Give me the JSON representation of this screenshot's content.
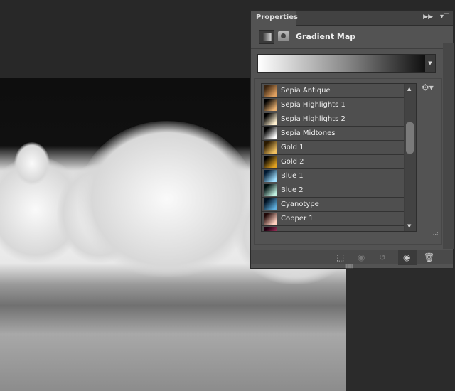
{
  "panel": {
    "tab": "Properties",
    "title": "Gradient Map",
    "collapse_icon": "double-arrow-right",
    "menu_icon": "panel-menu"
  },
  "gradient": {
    "from": "#ffffff",
    "to": "#000000"
  },
  "presets": [
    {
      "name": "Sepia Antique",
      "c": [
        "#3a2410",
        "#e0a060"
      ]
    },
    {
      "name": "Sepia Highlights 1",
      "c": [
        "#000000",
        "#e8b070"
      ]
    },
    {
      "name": "Sepia Highlights 2",
      "c": [
        "#000000",
        "#fff0d0"
      ]
    },
    {
      "name": "Sepia Midtones",
      "c": [
        "#000000",
        "#ffffff"
      ]
    },
    {
      "name": "Gold 1",
      "c": [
        "#2a1a00",
        "#f0c060"
      ]
    },
    {
      "name": "Gold 2",
      "c": [
        "#000000",
        "#e0a020"
      ]
    },
    {
      "name": "Blue 1",
      "c": [
        "#001830",
        "#a0e0ff"
      ]
    },
    {
      "name": "Blue 2",
      "c": [
        "#001010",
        "#c0f0e0"
      ]
    },
    {
      "name": "Cyanotype",
      "c": [
        "#001020",
        "#60b0e0"
      ]
    },
    {
      "name": "Copper 1",
      "c": [
        "#200808",
        "#ffd0c0"
      ]
    },
    {
      "name": "",
      "c": [
        "#200010",
        "#c04070"
      ]
    }
  ]
}
